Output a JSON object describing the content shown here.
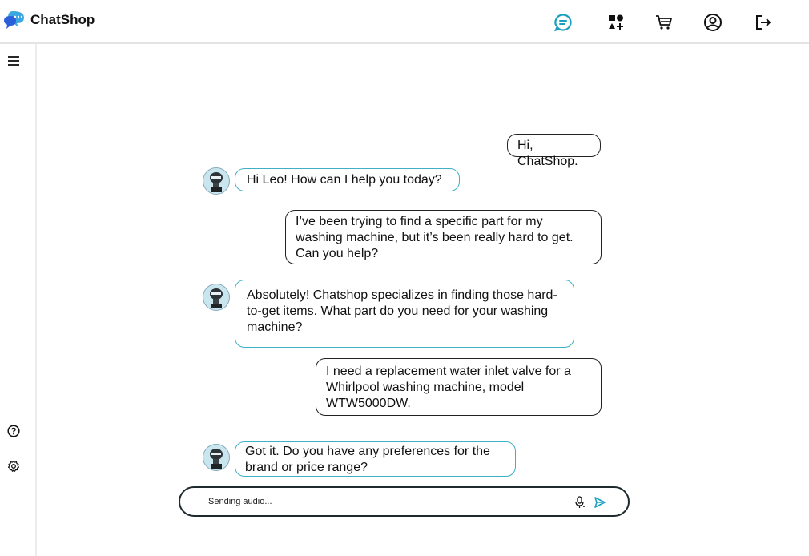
{
  "app": {
    "name": "ChatShop"
  },
  "header": {
    "icons": [
      "chat-icon",
      "categories-icon",
      "cart-icon",
      "account-icon",
      "logout-icon"
    ],
    "accent_color": "#1b9fc0"
  },
  "sidebar": {
    "icons": [
      "menu-icon",
      "help-icon",
      "settings-icon"
    ]
  },
  "messages": [
    {
      "role": "user",
      "text": "Hi, ChatShop."
    },
    {
      "role": "bot",
      "text": "Hi Leo! How can I help you today?"
    },
    {
      "role": "user",
      "text": "I’ve been trying to find a specific part for my washing machine, but it’s been really hard to get. Can you help?"
    },
    {
      "role": "bot",
      "text": "Absolutely! Chatshop specializes in finding those hard-to-get items. What part do you need for your washing machine?"
    },
    {
      "role": "user",
      "text": "I need a replacement water inlet valve for a Whirlpool washing machine, model WTW5000DW."
    },
    {
      "role": "bot",
      "text": "Got it. Do you have any preferences for the brand or price range?"
    }
  ],
  "composer": {
    "status_text": "Sending audio...",
    "icons": [
      "microphone-icon",
      "send-icon"
    ],
    "send_color": "#1b9fc0"
  },
  "colors": {
    "bot_border": "#3fb0c8",
    "user_border": "#222222"
  }
}
